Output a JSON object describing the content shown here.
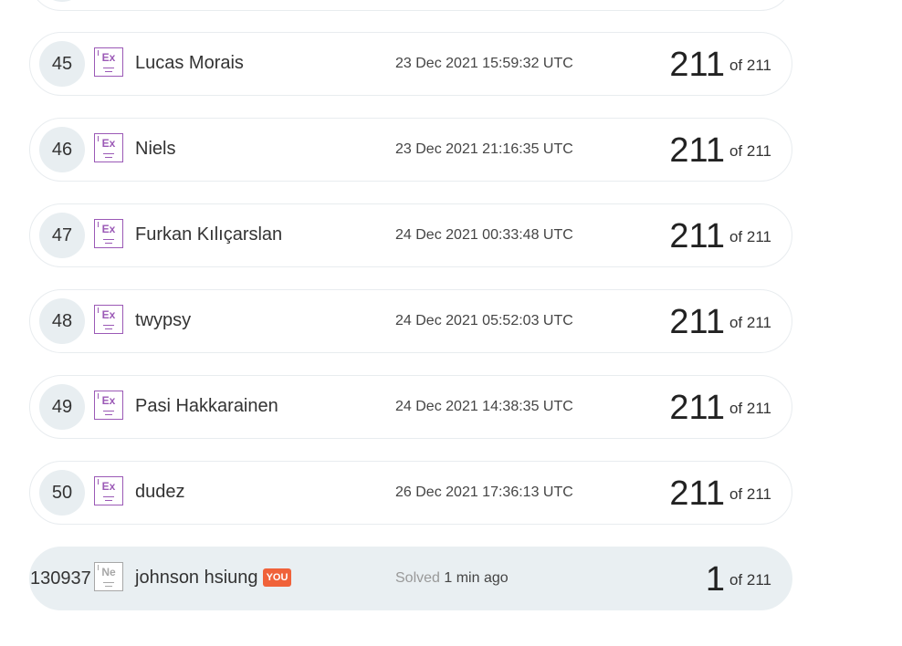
{
  "leaderboard": {
    "rows": [
      {
        "rank": "45",
        "badge": "Ex",
        "name": "Lucas Morais",
        "time": "23 Dec 2021 15:59:32 UTC",
        "score": "211",
        "of_label": "of",
        "total": "211"
      },
      {
        "rank": "46",
        "badge": "Ex",
        "name": "Niels",
        "time": "23 Dec 2021 21:16:35 UTC",
        "score": "211",
        "of_label": "of",
        "total": "211"
      },
      {
        "rank": "47",
        "badge": "Ex",
        "name": "Furkan Kılıçarslan",
        "time": "24 Dec 2021 00:33:48 UTC",
        "score": "211",
        "of_label": "of",
        "total": "211"
      },
      {
        "rank": "48",
        "badge": "Ex",
        "name": "twypsy",
        "time": "24 Dec 2021 05:52:03 UTC",
        "score": "211",
        "of_label": "of",
        "total": "211"
      },
      {
        "rank": "49",
        "badge": "Ex",
        "name": "Pasi Hakkarainen",
        "time": "24 Dec 2021 14:38:35 UTC",
        "score": "211",
        "of_label": "of",
        "total": "211"
      },
      {
        "rank": "50",
        "badge": "Ex",
        "name": "dudez",
        "time": "26 Dec 2021 17:36:13 UTC",
        "score": "211",
        "of_label": "of",
        "total": "211"
      }
    ],
    "current_user": {
      "rank": "130937",
      "badge": "Ne",
      "name": "johnson hsiung",
      "you_tag": "YOU",
      "solved_label": "Solved",
      "solved_time": "1 min ago",
      "score": "1",
      "of_label": "of",
      "total": "211"
    }
  },
  "colors": {
    "expert_badge": "#9b59b6",
    "newbie_badge": "#a7a7a7",
    "you_tag": "#f0623a",
    "current_row_bg": "#e9eff2"
  }
}
